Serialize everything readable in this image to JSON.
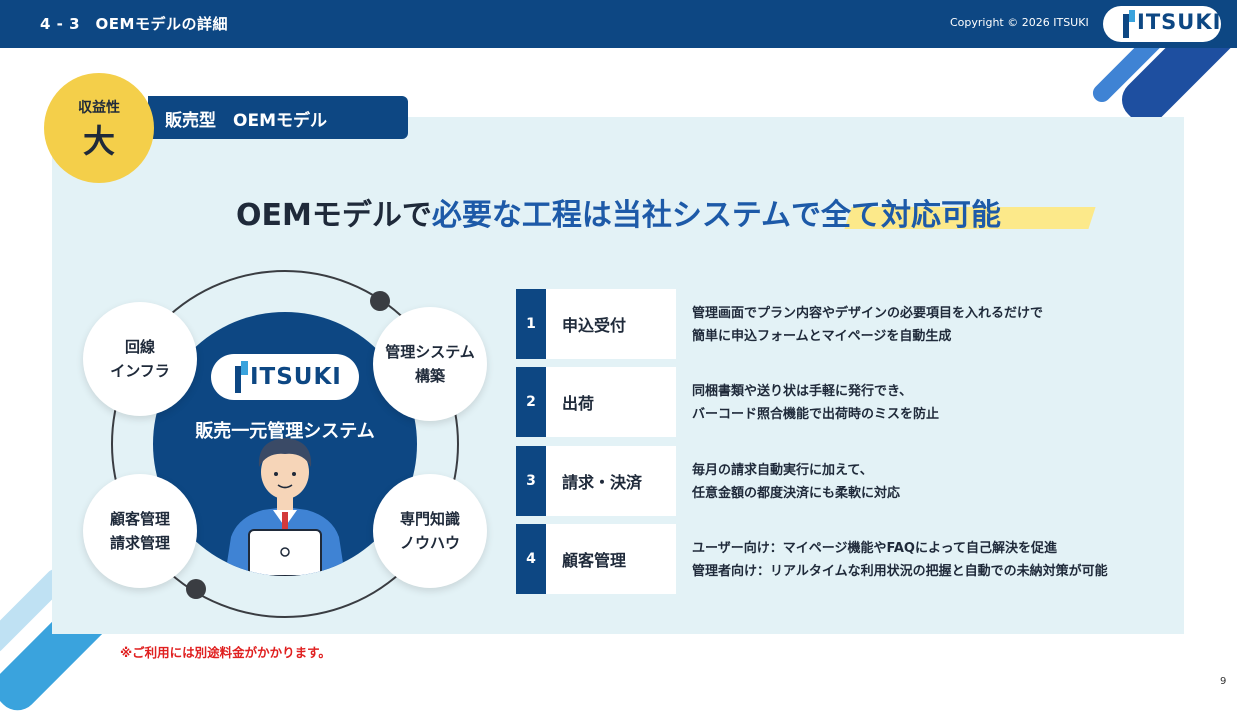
{
  "header": {
    "section_title": "4 - 3　OEMモデルの詳細",
    "copyright": "Copyright © 2026 ITSUKI",
    "logo_text": "ITSUKI"
  },
  "badge": {
    "small": "収益性",
    "big": "大"
  },
  "model_label": "販売型　OEMモデル",
  "headline": {
    "part1": "OEMモデルで",
    "part2": "必要な工程は当社システムで",
    "part3": "全て対応可能"
  },
  "center": {
    "logo_text": "ITSUKI",
    "title": "販売一元管理システム"
  },
  "satellites": [
    {
      "lines": [
        "回線",
        "インフラ"
      ]
    },
    {
      "lines": [
        "管理システム",
        "構築"
      ]
    },
    {
      "lines": [
        "顧客管理",
        "請求管理"
      ]
    },
    {
      "lines": [
        "専門知識",
        "ノウハウ"
      ]
    }
  ],
  "steps": [
    {
      "num": "1",
      "label": "申込受付",
      "desc": [
        "管理画面でプラン内容やデザインの必要項目を入れるだけで",
        "簡単に申込フォームとマイページを自動生成"
      ]
    },
    {
      "num": "2",
      "label": "出荷",
      "desc": [
        "同梱書類や送り状は手軽に発行でき、",
        "バーコード照合機能で出荷時のミスを防止"
      ]
    },
    {
      "num": "3",
      "label": "請求・決済",
      "desc": [
        "毎月の請求自動実行に加えて、",
        "任意金額の都度決済にも柔軟に対応"
      ]
    },
    {
      "num": "4",
      "label": "顧客管理",
      "desc": [
        "ユーザー向け：マイページ機能やFAQによって自己解決を促進",
        "管理者向け：リアルタイムな利用状況の把握と自動での未納対策が可能"
      ]
    }
  ],
  "note": "※ご利用には別途料金がかかります。",
  "page_number": "9",
  "colors": {
    "navy": "#0d4783",
    "accent_blue": "#1d5aa8",
    "yellow": "#f4cf4a",
    "highlight": "#fce98a",
    "panel": "#e3f2f6",
    "note_red": "#e02020"
  }
}
